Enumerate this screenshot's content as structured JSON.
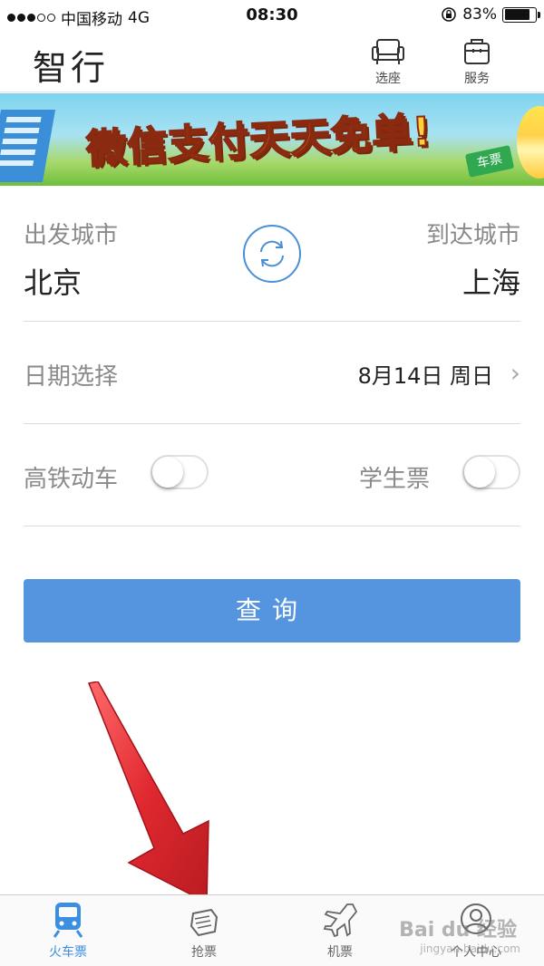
{
  "status_bar": {
    "carrier": "中国移动",
    "network": "4G",
    "time": "08:30",
    "battery": "83%",
    "battery_level": 0.83
  },
  "nav": {
    "title": "智行",
    "seat_label": "选座",
    "service_label": "服务"
  },
  "banner": {
    "headline": "微信支付天天免单!",
    "badge": "车票"
  },
  "form": {
    "from_label": "出发城市",
    "from_value": "北京",
    "to_label": "到达城市",
    "to_value": "上海",
    "date_label": "日期选择",
    "date_value": "8月14日 周日",
    "highspeed_label": "高铁动车",
    "student_label": "学生票",
    "highspeed_on": false,
    "student_on": false
  },
  "search_button": "查询",
  "tabs": [
    {
      "label": "火车票",
      "icon": "train-icon",
      "active": true
    },
    {
      "label": "抢票",
      "icon": "hand-icon",
      "active": false
    },
    {
      "label": "机票",
      "icon": "plane-icon",
      "active": false
    },
    {
      "label": "个人中心",
      "icon": "person-icon",
      "active": false
    }
  ],
  "watermark": {
    "brand": "Bai du 经验",
    "url": "jingyan.baidu.com"
  },
  "colors": {
    "accent": "#5595e0",
    "tab_active": "#3a8fe0",
    "arrow": "#e0282f"
  }
}
